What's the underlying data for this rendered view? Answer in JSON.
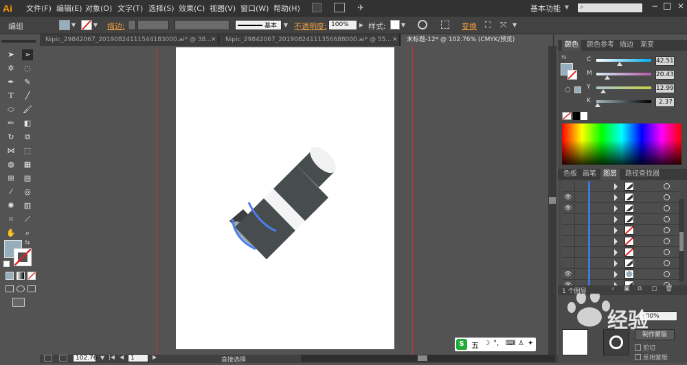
{
  "menubar": {
    "logo": "Ai",
    "items": [
      "文件(F)",
      "编辑(E)",
      "对象(O)",
      "文字(T)",
      "选择(S)",
      "效果(C)",
      "视图(V)",
      "窗口(W)",
      "帮助(H)"
    ],
    "workspace": "基本功能",
    "search_icon": "search-icon"
  },
  "control": {
    "selection_label": "编组",
    "stroke_label": "描边:",
    "stroke_style": "基本",
    "opacity_label": "不透明度:",
    "opacity_value": "100%",
    "style_label": "样式:",
    "transform_label": "变换"
  },
  "tabs": [
    {
      "label": "Nipic_29842067_20190824111544183000.ai* @ 38...",
      "active": false
    },
    {
      "label": "Nipic_29842067_20190824111356688000.ai* @ 55...",
      "active": false
    },
    {
      "label": "未标题-12* @ 102.76% (CMYK/预览)",
      "active": true
    }
  ],
  "color_panel": {
    "tabs": [
      "颜色",
      "颜色参考",
      "描边",
      "渐变"
    ],
    "channels": [
      {
        "name": "C",
        "value": "42.51",
        "level": 0.4251,
        "gradient": "linear-gradient(90deg,#fff,#00aeef)"
      },
      {
        "name": "M",
        "value": "20.43",
        "level": 0.2043,
        "gradient": "linear-gradient(90deg,#d8ecf4,#b45aa8)"
      },
      {
        "name": "Y",
        "value": "12.99",
        "level": 0.1299,
        "gradient": "linear-gradient(90deg,#a8c6d4,#c8d040)"
      },
      {
        "name": "K",
        "value": "2.37",
        "level": 0.0237,
        "gradient": "linear-gradient(90deg,#a2b5c0,#000)"
      }
    ],
    "fill_color": "#97aebc"
  },
  "layers_panel": {
    "tabs": [
      "色板",
      "画笔",
      "图层",
      "路径查找器"
    ],
    "rows": [
      {
        "eye": false,
        "thumb": "dark"
      },
      {
        "eye": true,
        "thumb": "dark"
      },
      {
        "eye": true,
        "thumb": "dark"
      },
      {
        "eye": false,
        "thumb": "dark"
      },
      {
        "eye": false,
        "thumb": "none"
      },
      {
        "eye": false,
        "thumb": "none"
      },
      {
        "eye": false,
        "thumb": "none"
      },
      {
        "eye": false,
        "thumb": "dark"
      },
      {
        "eye": true,
        "thumb": "blue"
      },
      {
        "eye": true,
        "thumb": "dark"
      }
    ],
    "footer": "1 个图层"
  },
  "transparency_panel": {
    "opacity": "100%",
    "make_mask": "制作蒙版",
    "clip": "剪切",
    "invert": "反相蒙版"
  },
  "status": {
    "zoom": "102.76",
    "artboard": "1",
    "tool": "直接选择"
  },
  "ime": {
    "label": "五"
  },
  "watermark": {
    "text": "经验"
  }
}
